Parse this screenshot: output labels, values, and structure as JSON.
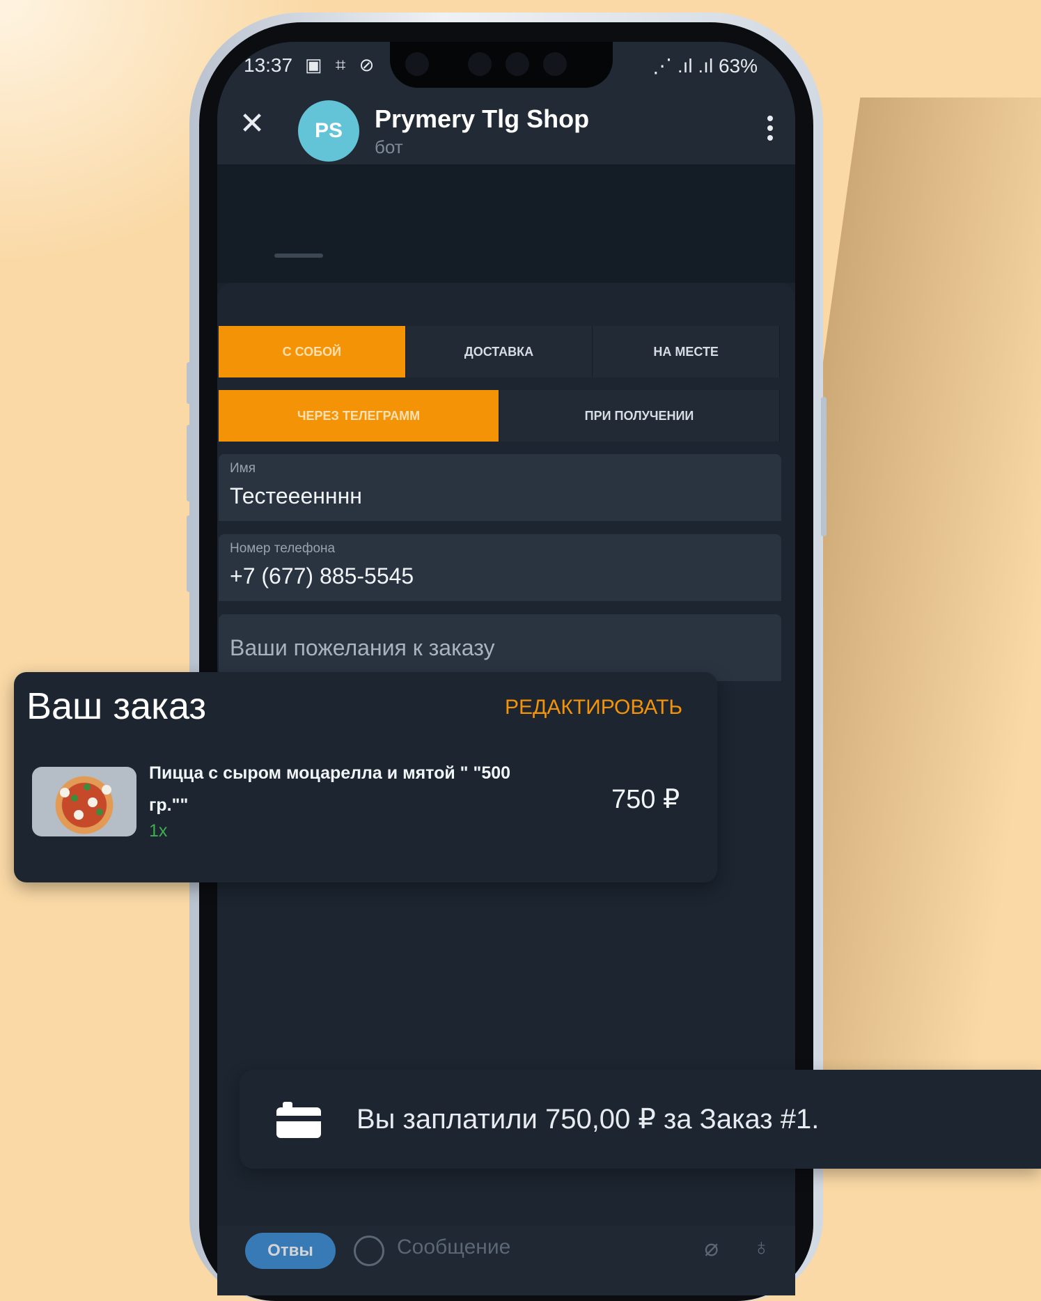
{
  "status_bar": {
    "time": "13:37",
    "left_icons": "▣ ⌗ ⊘",
    "right_info": "⋰ .ıl .ıl 63%"
  },
  "header": {
    "avatar_initials": "PS",
    "title": "Prymery Tlg Shop",
    "subtitle": "бот"
  },
  "order_type_tabs": [
    {
      "label": "С собой",
      "active": true
    },
    {
      "label": "Доставка",
      "active": false
    },
    {
      "label": "На месте",
      "active": false
    }
  ],
  "payment_tabs": [
    {
      "label": "Через Телеграмм",
      "active": true
    },
    {
      "label": "При получении",
      "active": false
    }
  ],
  "form": {
    "name_label": "Имя",
    "name_value": "Тестееенннн",
    "phone_label": "Номер телефона",
    "phone_value": "+7 (677) 885-5545",
    "comment_placeholder": "Ваши пожелания к заказу"
  },
  "order": {
    "title": "Ваш заказ",
    "edit_label": "РЕДАКТИРОВАТЬ",
    "item_name": "Пицца с сыром моцарелла и мятой \" \"500 гр.\"\"",
    "item_qty": "1x",
    "item_price": "750 ₽"
  },
  "payment_notice": "Вы заплатили 750,00 ₽ за Заказ #1.",
  "composer": {
    "left_button": "Отвы",
    "placeholder": "Сообщение"
  },
  "colors": {
    "accent": "#f59307",
    "background": "#fad9a6",
    "screen": "#1c2530"
  }
}
